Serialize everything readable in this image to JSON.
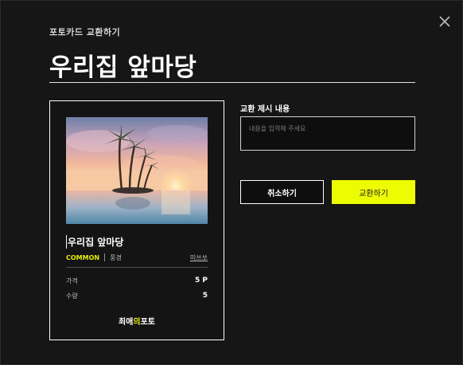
{
  "modal": {
    "subtitle": "포토카드 교환하기",
    "title": "우리집 앞마당",
    "close_icon": "close-icon"
  },
  "card": {
    "image_icon": "photo-palm-trees-sunset",
    "name": "우리집 앞마당",
    "rarity": "COMMON",
    "category": "풍경",
    "artist": "미쓰쏘",
    "price_label": "가격",
    "price_value": "5 P",
    "quantity_label": "수량",
    "quantity_value": "5",
    "brand_prefix": "최애",
    "brand_accent": "의",
    "brand_suffix": "포토"
  },
  "offer": {
    "label": "교환 제시 내용",
    "placeholder": "내용을 입력해 주세요",
    "value": ""
  },
  "buttons": {
    "cancel": "취소하기",
    "exchange": "교환하기"
  },
  "colors": {
    "background": "#161616",
    "accent": "#eefc00",
    "rarity": "#e6f000"
  }
}
